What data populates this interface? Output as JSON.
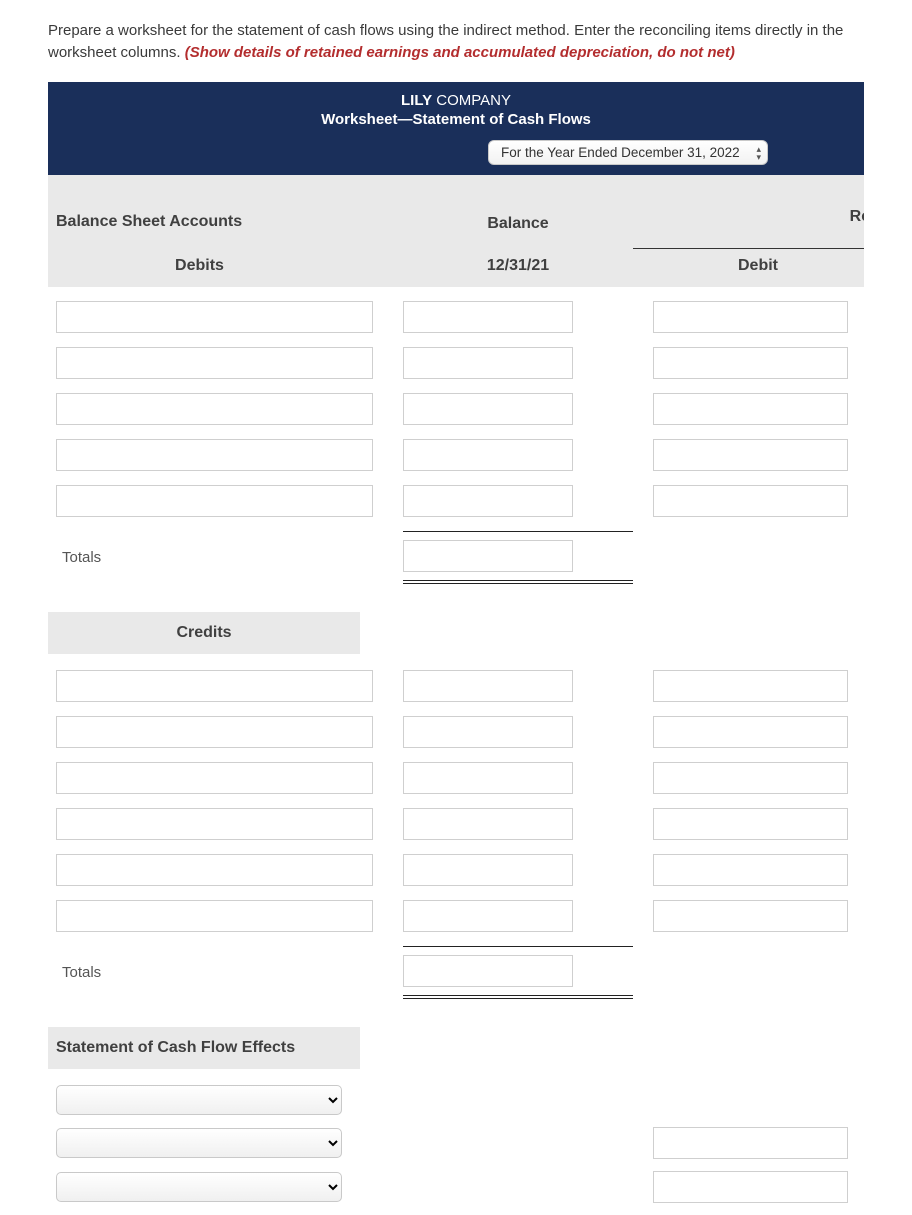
{
  "instruction": {
    "text": "Prepare a worksheet for the statement of cash flows using the indirect method. Enter the reconciling items directly in the worksheet columns. ",
    "hint": "(Show details of retained earnings and accumulated depreciation, do not net)"
  },
  "header": {
    "company_bold": "LILY",
    "company_rest": " COMPANY",
    "subtitle": "Worksheet—Statement of Cash Flows",
    "period": "For the Year Ended December 31, 2022"
  },
  "columns": {
    "accounts": "Balance Sheet Accounts",
    "balance": "Balance",
    "balance_date": "12/31/21",
    "rec": "Rec",
    "debit": "Debit"
  },
  "sections": {
    "debits": "Debits",
    "credits": "Credits",
    "totals": "Totals",
    "effects": "Statement of Cash Flow Effects"
  }
}
